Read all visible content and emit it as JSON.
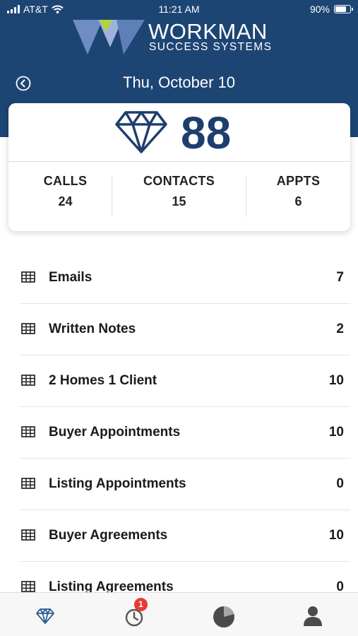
{
  "status_bar": {
    "carrier": "AT&T",
    "time": "11:21 AM",
    "battery": "90%",
    "battery_level": 0.9
  },
  "logo": {
    "title": "WORKMAN",
    "subtitle": "SUCCESS SYSTEMS"
  },
  "header": {
    "date": "Thu, October 10",
    "back_icon": "chevron-left-circle-icon"
  },
  "score": {
    "icon": "diamond-icon",
    "value": "88"
  },
  "metrics": [
    {
      "label": "CALLS",
      "value": "24"
    },
    {
      "label": "CONTACTS",
      "value": "15"
    },
    {
      "label": "APPTS",
      "value": "6"
    }
  ],
  "activities": [
    {
      "label": "Emails",
      "value": "7"
    },
    {
      "label": "Written Notes",
      "value": "2"
    },
    {
      "label": "2 Homes 1 Client",
      "value": "10"
    },
    {
      "label": "Buyer Appointments",
      "value": "10"
    },
    {
      "label": "Listing Appointments",
      "value": "0"
    },
    {
      "label": "Buyer Agreements",
      "value": "10"
    },
    {
      "label": "Listing Agreements",
      "value": "0"
    }
  ],
  "tabbar": {
    "tabs": [
      {
        "icon": "diamond-tab-icon",
        "active": true
      },
      {
        "icon": "clock-icon",
        "badge": "1"
      },
      {
        "icon": "pie-chart-icon"
      },
      {
        "icon": "user-icon"
      }
    ]
  },
  "colors": {
    "brand_navy": "#1d4574",
    "score_blue": "#1d3e6e",
    "badge_red": "#e63b35",
    "logo_green": "#b6d236",
    "logo_blue": "#7f9ccb"
  }
}
